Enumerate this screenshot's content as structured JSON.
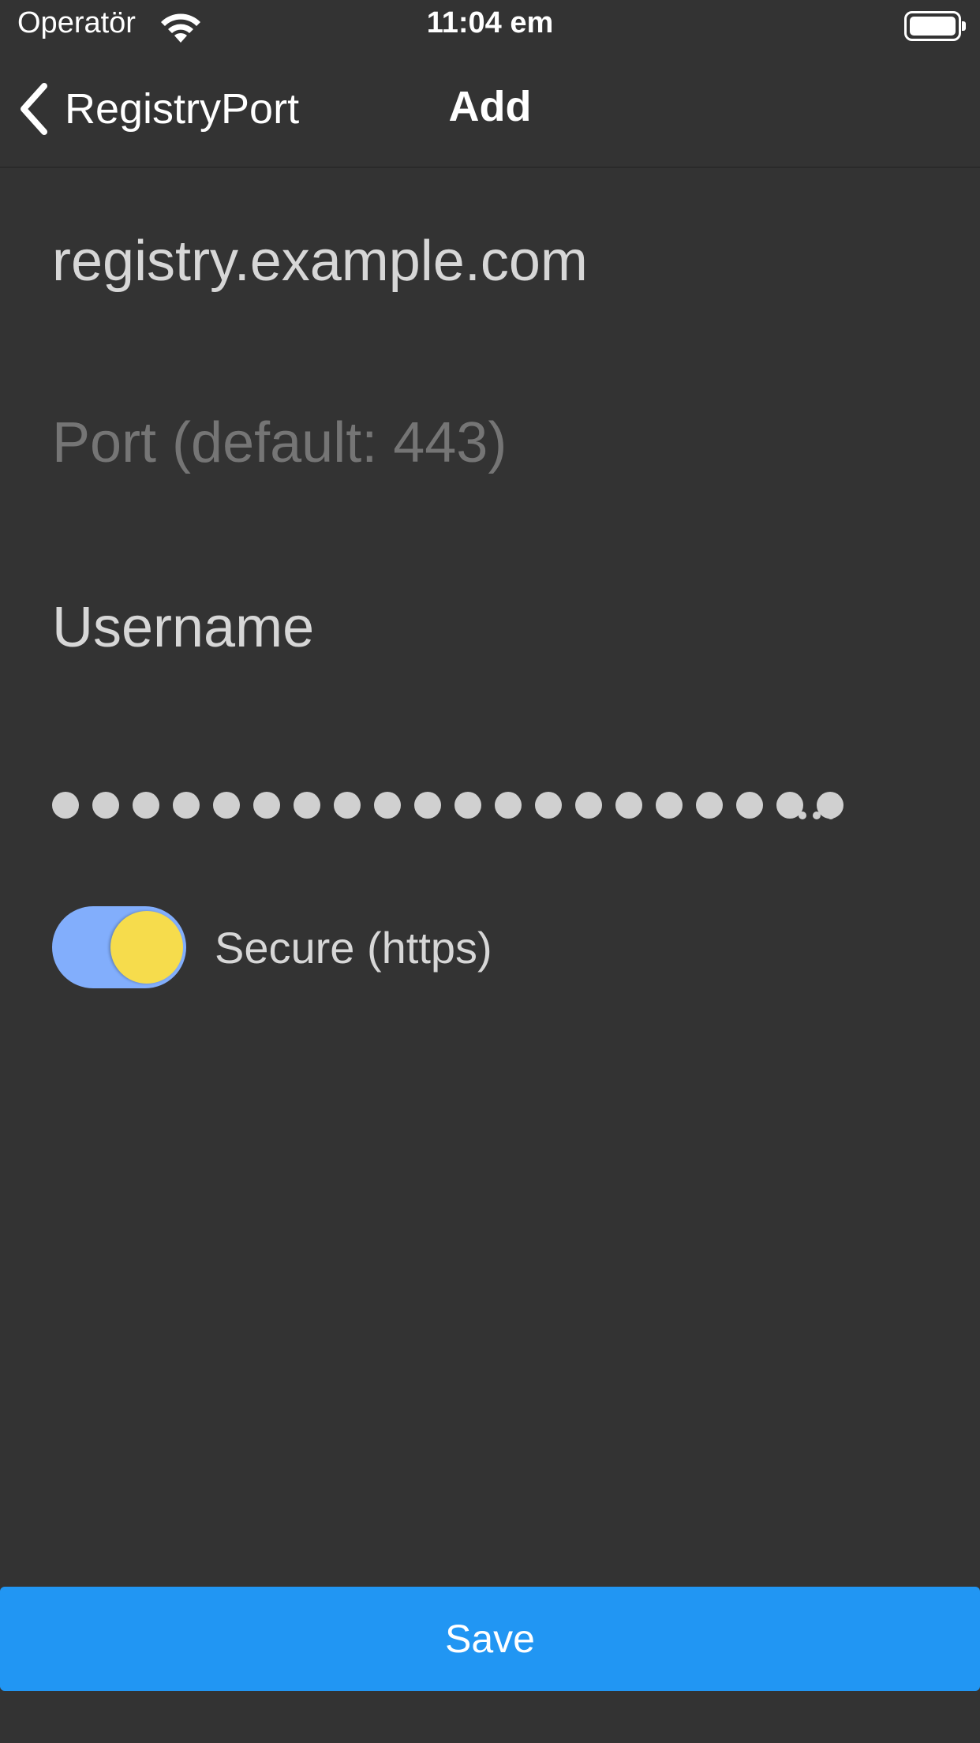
{
  "status_bar": {
    "carrier": "Operatör",
    "time": "11:04 em",
    "wifi_icon": "wifi-icon",
    "battery_icon": "battery-icon"
  },
  "nav": {
    "back_label": "RegistryPort",
    "back_icon": "chevron-left-icon",
    "title": "Add"
  },
  "form": {
    "host_value": "registry.example.com",
    "port_placeholder": "Port (default: 443)",
    "port_value": "",
    "username_value": "Username",
    "password_masked": "●●●●●●●●●●●●●●●●●●●●",
    "password_overflow": "...",
    "secure_label": "Secure (https)",
    "secure_enabled": true
  },
  "actions": {
    "save_label": "Save"
  },
  "colors": {
    "background": "#333333",
    "primary": "#2196f3",
    "switch_track": "#82aefc",
    "switch_knob": "#f6dc4c",
    "text": "#d7d7d7",
    "placeholder": "#6a6a6a"
  }
}
